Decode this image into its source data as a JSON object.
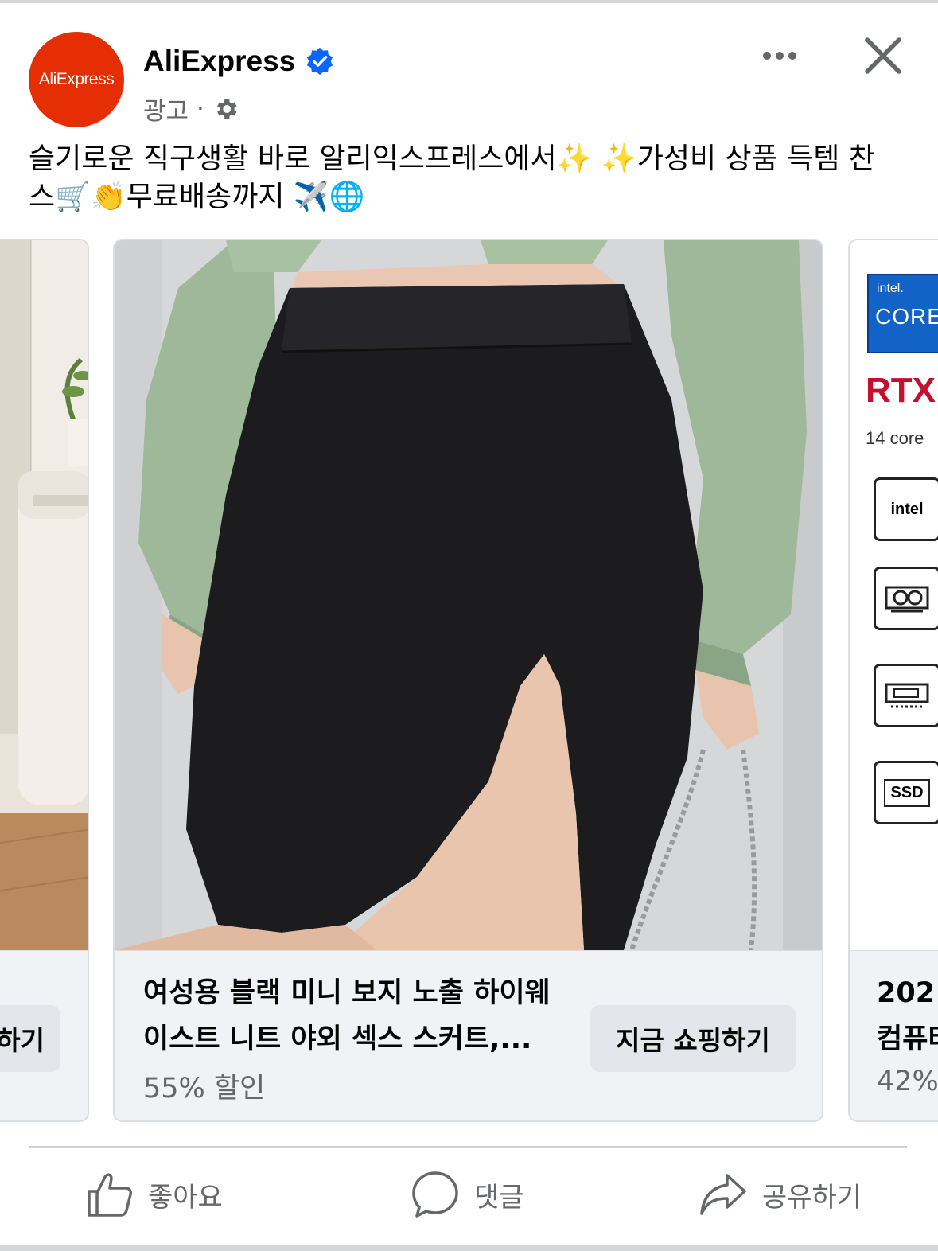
{
  "header": {
    "logo_text": "AliExpress",
    "page_name": "AliExpress",
    "sponsored_label": "광고",
    "separator": "·"
  },
  "caption": {
    "line1": "슬기로운 직구생활 바로 알리익스프레스에서✨ ✨가성비 상품 득템 찬",
    "line2": "스🛒👏무료배송까지 ✈️🌐"
  },
  "carousel": {
    "left_card": {
      "button_label": "지금 쇼핑하기",
      "button_visible_fragment": "하기"
    },
    "main_card": {
      "title_line1": "여성용 블랙 미니 보지 노출 하이웨",
      "title_line2": "이스트 니트 야외 섹스 스커트,...",
      "discount": "55% 할인",
      "button_label": "지금 쇼핑하기"
    },
    "right_card": {
      "image_texts": {
        "intel_small": "intel.",
        "core": "CORE",
        "rtx": "RTX",
        "cores": "14 core",
        "intel_logo": "intel",
        "ssd": "SSD"
      },
      "title_line1": "202",
      "title_line2": "컴퓨터",
      "discount": "42%"
    }
  },
  "actions": {
    "like": "좋아요",
    "comment": "댓글",
    "share": "공유하기"
  },
  "colors": {
    "brand_red": "#e62e04",
    "verified_blue": "#0866ff",
    "secondary_text": "#65676b",
    "button_bg": "#e4e6eb",
    "card_bg": "#f0f2f5"
  }
}
